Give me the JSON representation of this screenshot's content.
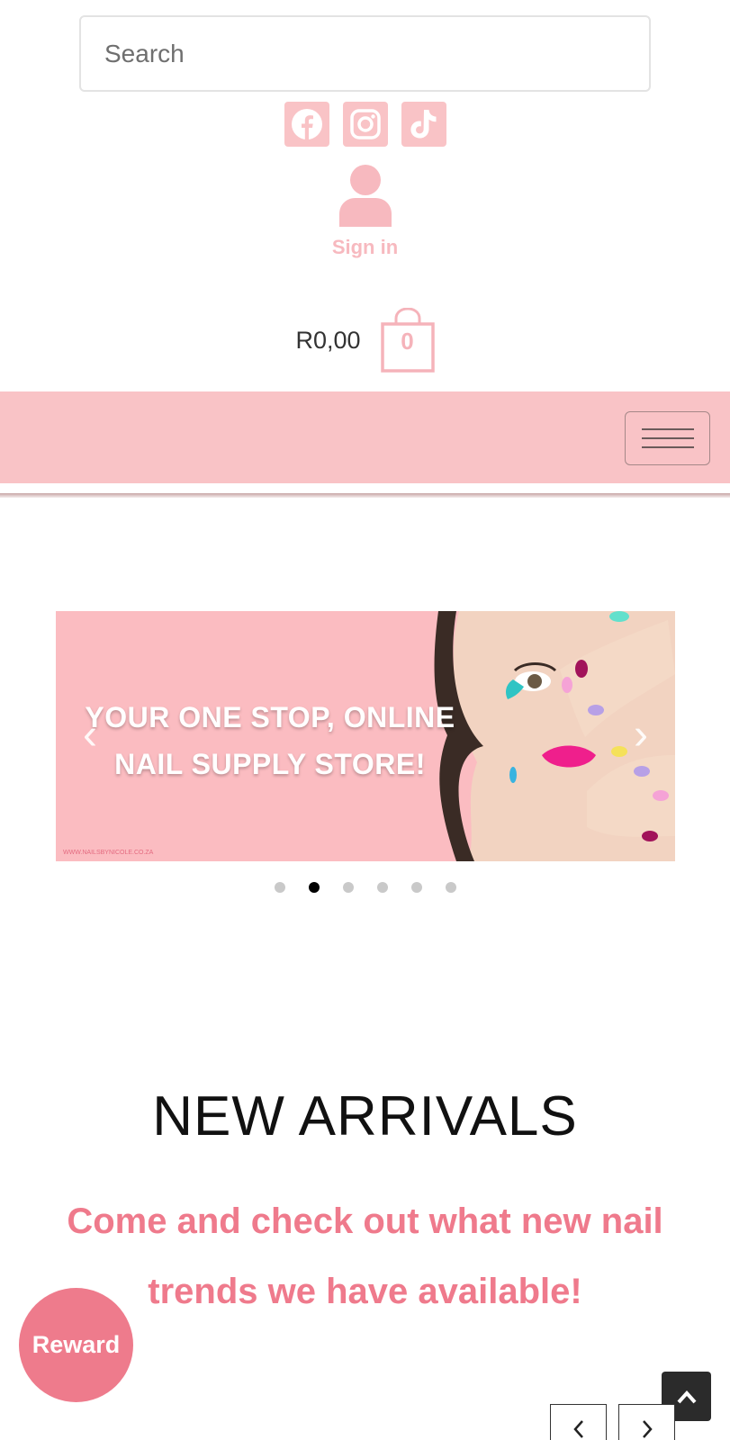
{
  "search": {
    "placeholder": "Search"
  },
  "social": [
    {
      "name": "facebook-icon"
    },
    {
      "name": "instagram-icon"
    },
    {
      "name": "tiktok-icon"
    }
  ],
  "account": {
    "signin_label": "Sign in"
  },
  "cart": {
    "total": "R0,00",
    "count": "0"
  },
  "banner": {
    "headline_line1": "YOUR ONE STOP, ONLINE",
    "headline_line2": "NAIL SUPPLY STORE!",
    "url": "WWW.NAILSBYNICOLE.CO.ZA",
    "prev_arrow": "‹",
    "next_arrow": "›",
    "slide_count": 6,
    "active_slide": 2
  },
  "new_arrivals": {
    "title": "NEW ARRIVALS",
    "subtitle": "Come and check out what new nail trends we have available!"
  },
  "reward_button": {
    "label": "Reward"
  },
  "colors": {
    "brand_pink": "#f9c3c6",
    "accent_pink": "#ef7a8c",
    "reward_pink": "#ee7b8c",
    "dark": "#2b2b2b"
  }
}
